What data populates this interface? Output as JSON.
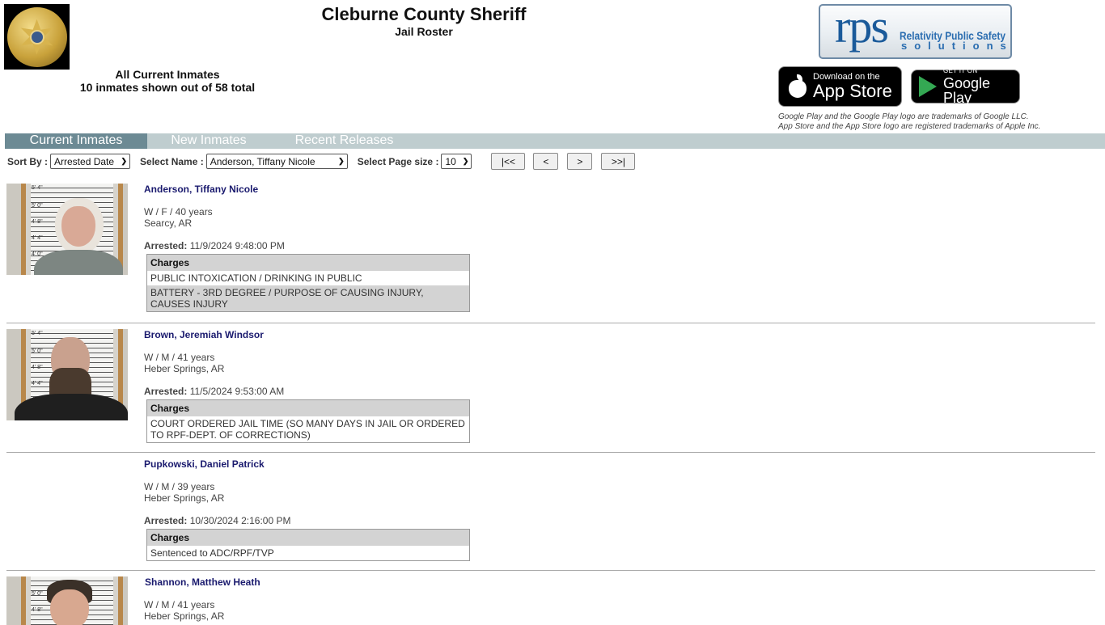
{
  "header": {
    "title": "Cleburne County Sheriff",
    "subtitle": "Jail Roster",
    "badge_alt": "Sheriff's Office Cleburne County badge"
  },
  "summary": {
    "heading": "All Current Inmates",
    "count_text": "10 inmates shown out of 58 total"
  },
  "vendor": {
    "logo_big": "rps",
    "logo_line1": "Relativity Public Safety",
    "logo_line2": "solutions"
  },
  "stores": {
    "appstore_small": "Download on the",
    "appstore_big": "App Store",
    "googleplay_small": "GET IT ON",
    "googleplay_big": "Google Play",
    "trademark_line1": "Google Play and the Google Play logo are trademarks of Google LLC.",
    "trademark_line2": "App Store and the App Store logo are registered trademarks of Apple Inc."
  },
  "tabs": [
    {
      "label": "Current Inmates",
      "active": true
    },
    {
      "label": "New Inmates",
      "active": false
    },
    {
      "label": "Recent Releases",
      "active": false
    }
  ],
  "controls": {
    "sort_label": "Sort By :",
    "sort_value": "Arrested Date",
    "name_label": "Select Name :",
    "name_value": "Anderson, Tiffany Nicole",
    "pagesize_label": "Select Page size :",
    "pagesize_value": "10",
    "first_label": "|<<",
    "prev_label": "<",
    "next_label": ">",
    "last_label": ">>|"
  },
  "inmates": [
    {
      "name": "Anderson, Tiffany Nicole",
      "demographics": "W / F / 40 years",
      "city": "Searcy, AR",
      "arrested_label": "Arrested:",
      "arrested": "11/9/2024 9:48:00 PM",
      "charges_header": "Charges",
      "charges": [
        "PUBLIC INTOXICATION / DRINKING IN PUBLIC",
        "BATTERY - 3RD DEGREE / PURPOSE OF CAUSING INJURY, CAUSES INJURY"
      ],
      "has_photo": true
    },
    {
      "name": "Brown, Jeremiah Windsor",
      "demographics": "W / M / 41 years",
      "city": "Heber Springs, AR",
      "arrested_label": "Arrested:",
      "arrested": "11/5/2024 9:53:00 AM",
      "charges_header": "Charges",
      "charges": [
        "COURT ORDERED JAIL TIME (SO MANY DAYS IN JAIL OR ORDERED TO RPF-DEPT. OF CORRECTIONS)"
      ],
      "has_photo": true
    },
    {
      "name": "Pupkowski, Daniel Patrick",
      "demographics": "W / M / 39 years",
      "city": "Heber Springs, AR",
      "arrested_label": "Arrested:",
      "arrested": "10/30/2024 2:16:00 PM",
      "charges_header": "Charges",
      "charges": [
        "Sentenced to ADC/RPF/TVP"
      ],
      "has_photo": false
    },
    {
      "name": "Shannon, Matthew Heath",
      "demographics": "W / M / 41 years",
      "city": "Heber Springs, AR",
      "has_photo": true
    }
  ],
  "height_marks": [
    "5' 4\"",
    "5' 0\"",
    "4' 8\"",
    "4' 4\"",
    "4' 0\""
  ]
}
